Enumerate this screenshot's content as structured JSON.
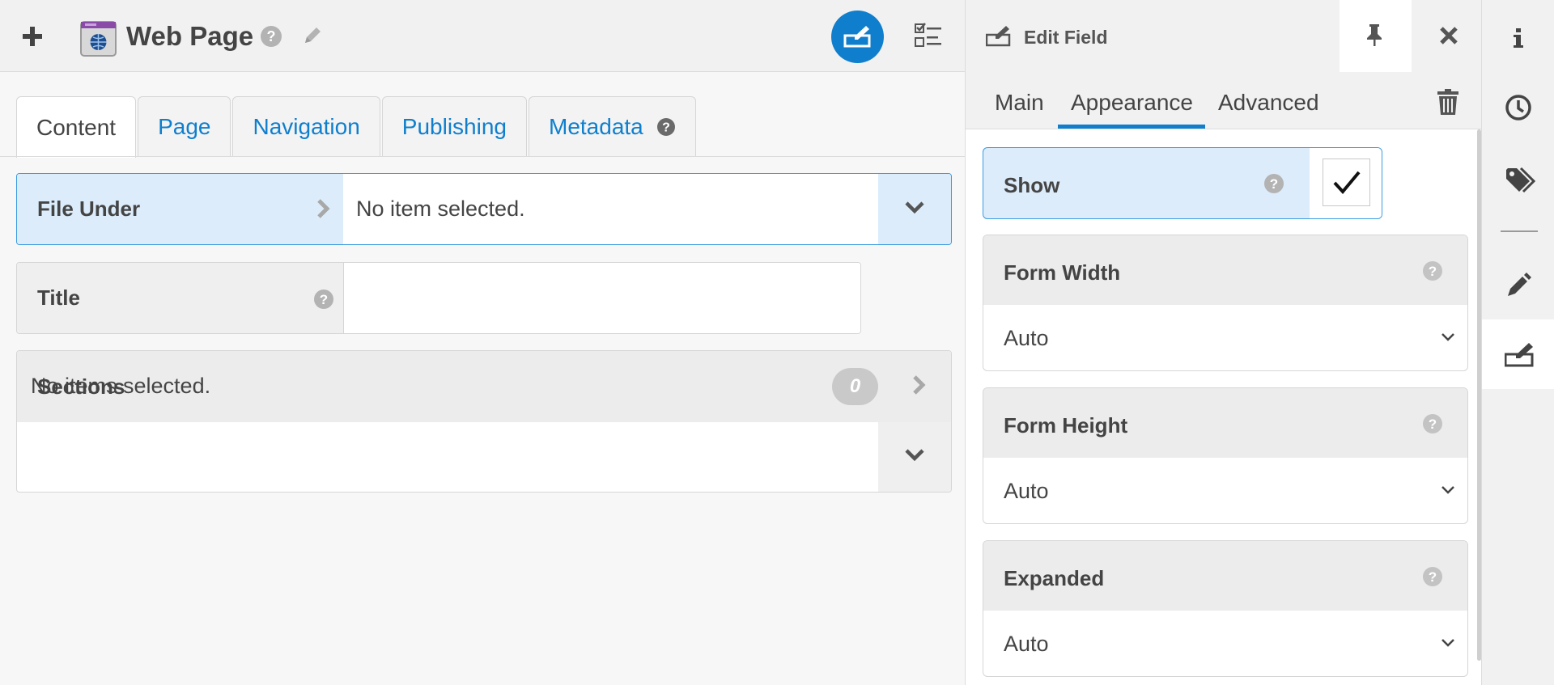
{
  "header": {
    "title": "Web Page",
    "icons": [
      "plus-icon",
      "web-page-type-icon",
      "help-icon",
      "pencil-icon",
      "edit-mode-icon",
      "checklist-icon"
    ]
  },
  "tabs": [
    {
      "label": "Content",
      "active": true
    },
    {
      "label": "Page",
      "active": false
    },
    {
      "label": "Navigation",
      "active": false
    },
    {
      "label": "Publishing",
      "active": false
    },
    {
      "label": "Metadata",
      "active": false,
      "help": true
    }
  ],
  "fields": {
    "file_under": {
      "label": "File Under",
      "value": "No item selected."
    },
    "title": {
      "label": "Title",
      "value": ""
    },
    "sections": {
      "label": "Sections",
      "value": "No items selected.",
      "count": "0"
    }
  },
  "panel": {
    "title": "Edit Field",
    "tabs": [
      {
        "label": "Main",
        "active": false
      },
      {
        "label": "Appearance",
        "active": true
      },
      {
        "label": "Advanced",
        "active": false
      }
    ],
    "show": {
      "label": "Show",
      "checked": true
    },
    "form_width": {
      "label": "Form Width",
      "value": "Auto"
    },
    "form_height": {
      "label": "Form Height",
      "value": "Auto"
    },
    "expanded": {
      "label": "Expanded",
      "value": "Auto"
    }
  },
  "rail": {
    "items": [
      "info-icon",
      "history-icon",
      "tags-icon",
      "pencil-icon",
      "edit-field-icon"
    ],
    "active": "edit-field-icon"
  },
  "colors": {
    "accent": "#0f7fcd",
    "focus_border": "#3a9be0",
    "focus_fill": "#dcecfb",
    "badge": "#c9c9c9"
  }
}
